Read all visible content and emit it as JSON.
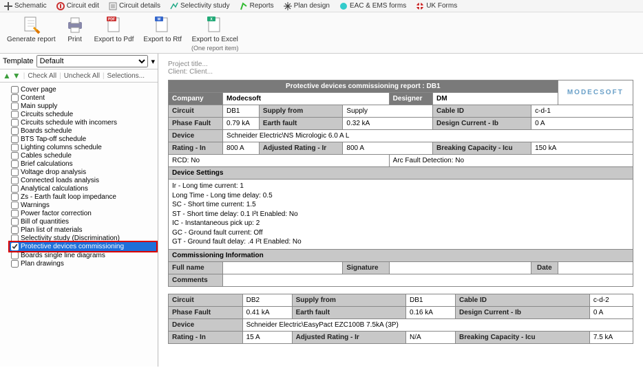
{
  "tabs": {
    "schematic": "Schematic",
    "circuit_edit": "Circuit edit",
    "circuit_details": "Circuit details",
    "selectivity_study": "Selectivity study",
    "reports": "Reports",
    "plan_design": "Plan design",
    "eac_ems": "EAC & EMS forms",
    "uk_forms": "UK Forms"
  },
  "ribbon": {
    "generate_report": "Generate report",
    "print": "Print",
    "export_pdf": "Export to Pdf",
    "export_rtf": "Export to Rtf",
    "export_excel": "Export to Excel",
    "export_excel_sub": "(One report item)"
  },
  "template": {
    "label": "Template",
    "value": "Default",
    "check_all": "Check All",
    "uncheck_all": "Uncheck All",
    "selections": "Selections..."
  },
  "tree": [
    {
      "label": "Cover page",
      "checked": false
    },
    {
      "label": "Content",
      "checked": false
    },
    {
      "label": "Main supply",
      "checked": false
    },
    {
      "label": "Circuits schedule",
      "checked": false
    },
    {
      "label": "Circuits schedule with incomers",
      "checked": false
    },
    {
      "label": "Boards schedule",
      "checked": false
    },
    {
      "label": "BTS Tap-off schedule",
      "checked": false
    },
    {
      "label": "Lighting columns schedule",
      "checked": false
    },
    {
      "label": "Cables schedule",
      "checked": false
    },
    {
      "label": "Brief calculations",
      "checked": false
    },
    {
      "label": "Voltage drop analysis",
      "checked": false
    },
    {
      "label": "Connected loads analysis",
      "checked": false
    },
    {
      "label": "Analytical calculations",
      "checked": false
    },
    {
      "label": "Zs - Earth fault loop impedance",
      "checked": false
    },
    {
      "label": "Warnings",
      "checked": false
    },
    {
      "label": "Power factor correction",
      "checked": false
    },
    {
      "label": "Bill of quantities",
      "checked": false
    },
    {
      "label": "Plan list of materials",
      "checked": false
    },
    {
      "label": "Selectivity study (Discrimination)",
      "checked": false
    },
    {
      "label": "Protective devices commissioning",
      "checked": true,
      "highlight": true
    },
    {
      "label": "Boards single line diagrams",
      "checked": false
    },
    {
      "label": "Plan drawings",
      "checked": false
    }
  ],
  "meta": {
    "project_title": "Project title...",
    "client": "Client: Client..."
  },
  "report_title": "Protective devices commissioning report : DB1",
  "logo": "MODECSOFT",
  "header": {
    "company_lbl": "Company",
    "company_val": "Modecsoft",
    "designer_lbl": "Designer",
    "designer_val": "DM"
  },
  "db1": {
    "circuit_lbl": "Circuit",
    "circuit": "DB1",
    "supply_from_lbl": "Supply from",
    "supply_from": "Supply",
    "cable_id_lbl": "Cable ID",
    "cable_id": "c-d-1",
    "phase_fault_lbl": "Phase Fault",
    "phase_fault": "0.79 kA",
    "earth_fault_lbl": "Earth fault",
    "earth_fault": "0.32 kA",
    "design_current_lbl": "Design Current - Ib",
    "design_current": "0 A",
    "device_lbl": "Device",
    "device": "Schneider Electric\\NS Micrologic 6.0 A L",
    "rating_in_lbl": "Rating - In",
    "rating_in": "800 A",
    "adj_rating_lbl": "Adjusted Rating - Ir",
    "adj_rating": "800 A",
    "breaking_cap_lbl": "Breaking Capacity - Icu",
    "breaking_cap": "150 kA",
    "rcd": "RCD: No",
    "arc_fault": "Arc Fault Detection: No",
    "device_settings_lbl": "Device Settings",
    "settings": [
      "Ir - Long time current: 1",
      "Long Time - Long time delay: 0.5",
      "SC - Short time current: 1.5",
      "ST - Short time delay: 0.1 I²t Enabled: No",
      "IC - Instantaneous pick up: 2",
      "GC - Ground fault current: Off",
      "GT - Ground fault delay: .4 I²t Enabled: No"
    ],
    "comm_info_lbl": "Commissioning Information",
    "full_name_lbl": "Full name",
    "signature_lbl": "Signature",
    "date_lbl": "Date",
    "comments_lbl": "Comments"
  },
  "db2": {
    "circuit_lbl": "Circuit",
    "circuit": "DB2",
    "supply_from_lbl": "Supply from",
    "supply_from": "DB1",
    "cable_id_lbl": "Cable ID",
    "cable_id": "c-d-2",
    "phase_fault_lbl": "Phase Fault",
    "phase_fault": "0.41 kA",
    "earth_fault_lbl": "Earth fault",
    "earth_fault": "0.16 kA",
    "design_current_lbl": "Design Current - Ib",
    "design_current": "0 A",
    "device_lbl": "Device",
    "device": "Schneider Electric\\EasyPact EZC100B 7.5kA (3P)",
    "rating_in_lbl": "Rating - In",
    "rating_in": "15 A",
    "adj_rating_lbl": "Adjusted Rating - Ir",
    "adj_rating": "N/A",
    "breaking_cap_lbl": "Breaking Capacity - Icu",
    "breaking_cap": "7.5 kA"
  }
}
